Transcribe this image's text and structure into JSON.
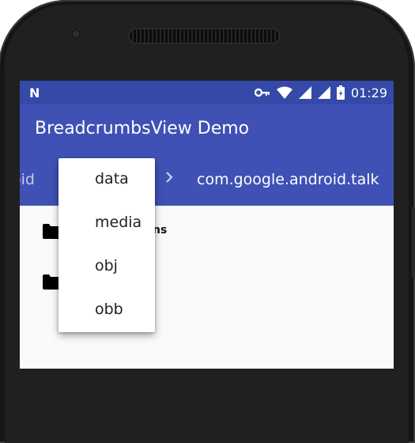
{
  "status_bar": {
    "notification_icon": "N",
    "icons": [
      "key-icon",
      "wifi-icon",
      "signal-icon",
      "battery-icon"
    ],
    "time": "01:29"
  },
  "toolbar": {
    "title": "BreadcrumbsView Demo",
    "color": "#3f51b5"
  },
  "breadcrumbs": {
    "partial_left": "oid",
    "separator": "chevron-right-icon",
    "current": "com.google.android.talk"
  },
  "list": {
    "items": [
      {
        "icon": "folder-icon",
        "label": "ns"
      },
      {
        "icon": "folder-icon",
        "label": ""
      }
    ]
  },
  "popup_menu": {
    "items": [
      "data",
      "media",
      "obj",
      "obb"
    ]
  }
}
